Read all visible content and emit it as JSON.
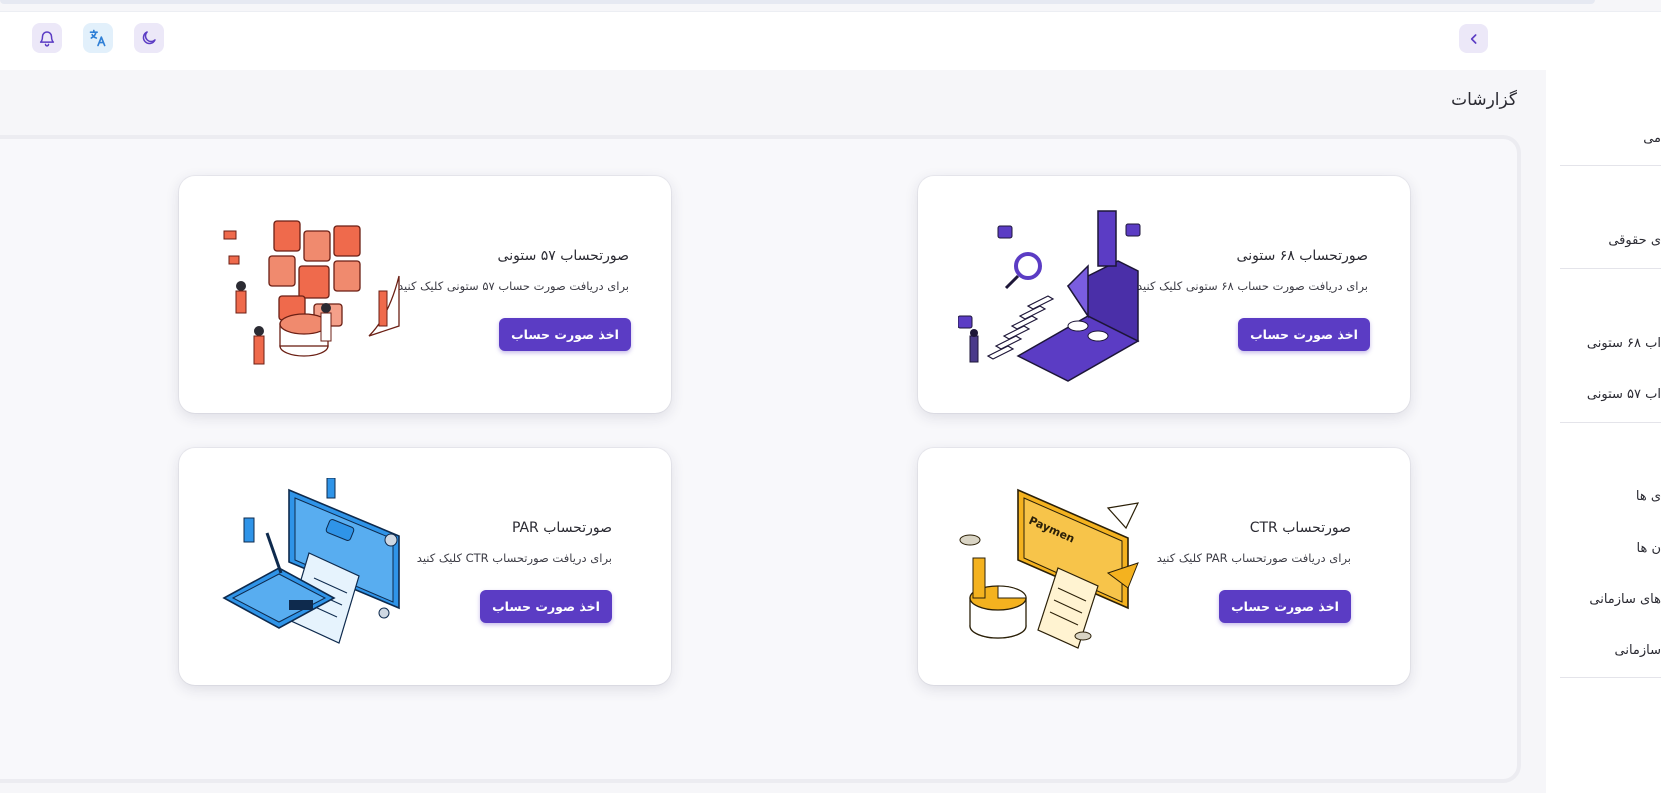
{
  "header": {
    "notifications_icon": "bell-icon",
    "language_icon": "translate-icon",
    "theme_icon": "moon-icon",
    "sidebar_toggle_icon": "chevron-left-icon"
  },
  "sidebar": {
    "items": [
      "می",
      "ی حقوقی",
      "اب ۶۸ ستونی",
      "اب ۵۷ ستونی",
      "ی ها",
      "ن ها",
      "های سازمانی",
      "سازمانی"
    ]
  },
  "page": {
    "title": "گزارشات"
  },
  "cards": [
    {
      "title": "صورتحساب ۶۸ ستونی",
      "description": "برای دریافت صورت حساب ۶۸ ستونی کلیک کنید.",
      "button": "اخذ صورت حساب",
      "illustration": "isometric-stairs-illustration",
      "accent": "#5b3cc4"
    },
    {
      "title": "صورتحساب ۵۷ ستونی",
      "description": "برای دریافت صورت حساب ۵۷ ستونی کلیک کنید.",
      "button": "اخذ صورت حساب",
      "illustration": "isometric-screens-illustration",
      "accent": "#ef6a4c"
    },
    {
      "title": "صورتحساب CTR",
      "description": "برای دریافت صورتحساب PAR کلیک کنید",
      "button": "اخذ صورت حساب",
      "illustration": "isometric-payment-monitor-illustration",
      "accent": "#f4b21f"
    },
    {
      "title": "صورتحساب PAR",
      "description": "برای دریافت صورتحساب CTR کلیک کنید",
      "button": "اخذ صورت حساب",
      "illustration": "isometric-phone-payment-illustration",
      "accent": "#2f94e8"
    }
  ],
  "colors": {
    "primary": "#5b3cc4",
    "background": "#f6f6f9",
    "card": "#ffffff"
  }
}
